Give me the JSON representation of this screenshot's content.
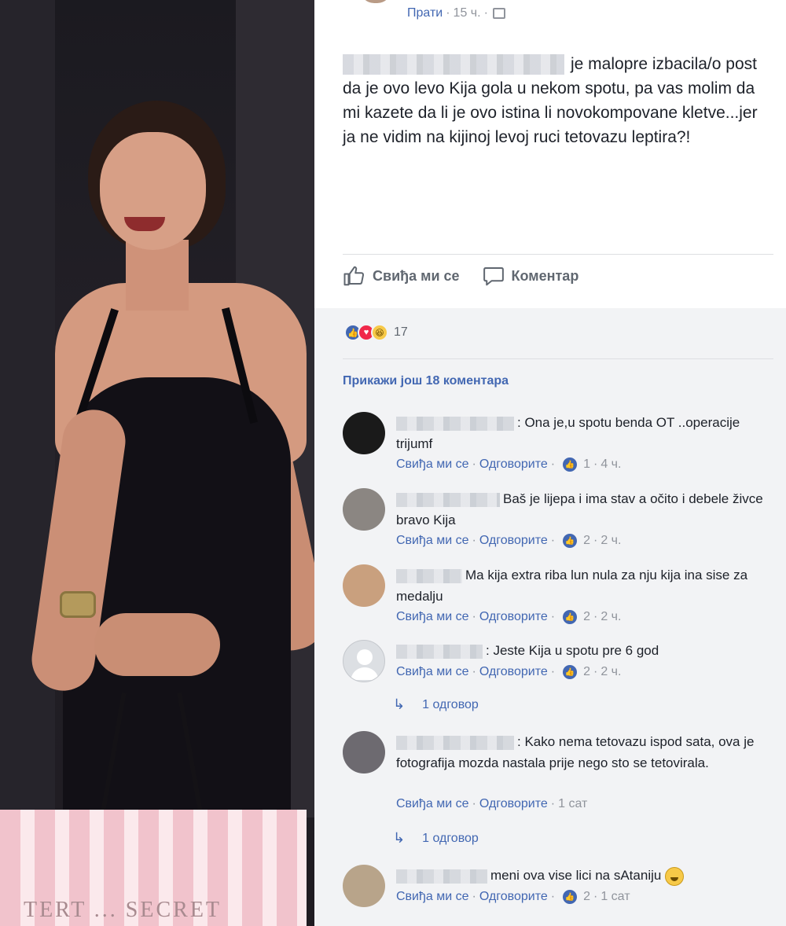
{
  "post": {
    "meta": {
      "follow_label": "Прати",
      "separator": "·",
      "time": "15 ч."
    },
    "text": "je malopre izbacila/o post da je ovo levo Kija gola u nekom spotu, pa vas molim da mi kazete da li je ovo istina li novokompovane kletve...jer ja ne vidim na kijinoj levoj ruci tetovazu leptira?!",
    "actions": {
      "like_label": "Свиђа ми се",
      "comment_label": "Коментар"
    },
    "reactions": {
      "count": "17"
    },
    "more_comments_label": "Прикажи још 18 коментара"
  },
  "comments": [
    {
      "text": ": Ona je,u spotu benda OT ..operacije trijumf",
      "like_label": "Свиђа ми се",
      "reply_label": "Одговорите",
      "likes": "1",
      "time": "4 ч.",
      "avatar_color": "#1a1a1a"
    },
    {
      "text": "Baš je lijepa i ima stav a očito i debele živce bravo Kija",
      "like_label": "Свиђа ми се",
      "reply_label": "Одговорите",
      "likes": "2",
      "time": "2 ч.",
      "avatar_color": "#8b8682"
    },
    {
      "text": "Ma kija extra riba lun nula za nju kija ina sise za medalju",
      "like_label": "Свиђа ми се",
      "reply_label": "Одговорите",
      "likes": "2",
      "time": "2 ч.",
      "avatar_color": "#c9a07e"
    },
    {
      "text": ": Jeste Kija u spotu pre 6 god",
      "like_label": "Свиђа ми се",
      "reply_label": "Одговорите",
      "likes": "2",
      "time": "2 ч.",
      "avatar_color": "#dcdfe3",
      "reply_count_label": "1 одговор"
    },
    {
      "text": ": Kako nema tetovazu ispod sata, ova je fotografija mozda nastala prije nego sto se tetovirala.",
      "like_label": "Свиђа ми се",
      "reply_label": "Одговорите",
      "time": "1 сат",
      "avatar_color": "#6d6a70",
      "reply_count_label": "1 одговор"
    },
    {
      "text": "meni ova vise lici na sAtaniju",
      "like_label": "Свиђа ми се",
      "reply_label": "Одговорите",
      "likes": "2",
      "time": "1 сат",
      "avatar_color": "#b8a48a"
    }
  ],
  "photo": {
    "bag_text": "TERT ... SECRET"
  },
  "colors": {
    "link": "#4267b2",
    "meta": "#90949c",
    "comments_bg": "#f2f3f5"
  }
}
